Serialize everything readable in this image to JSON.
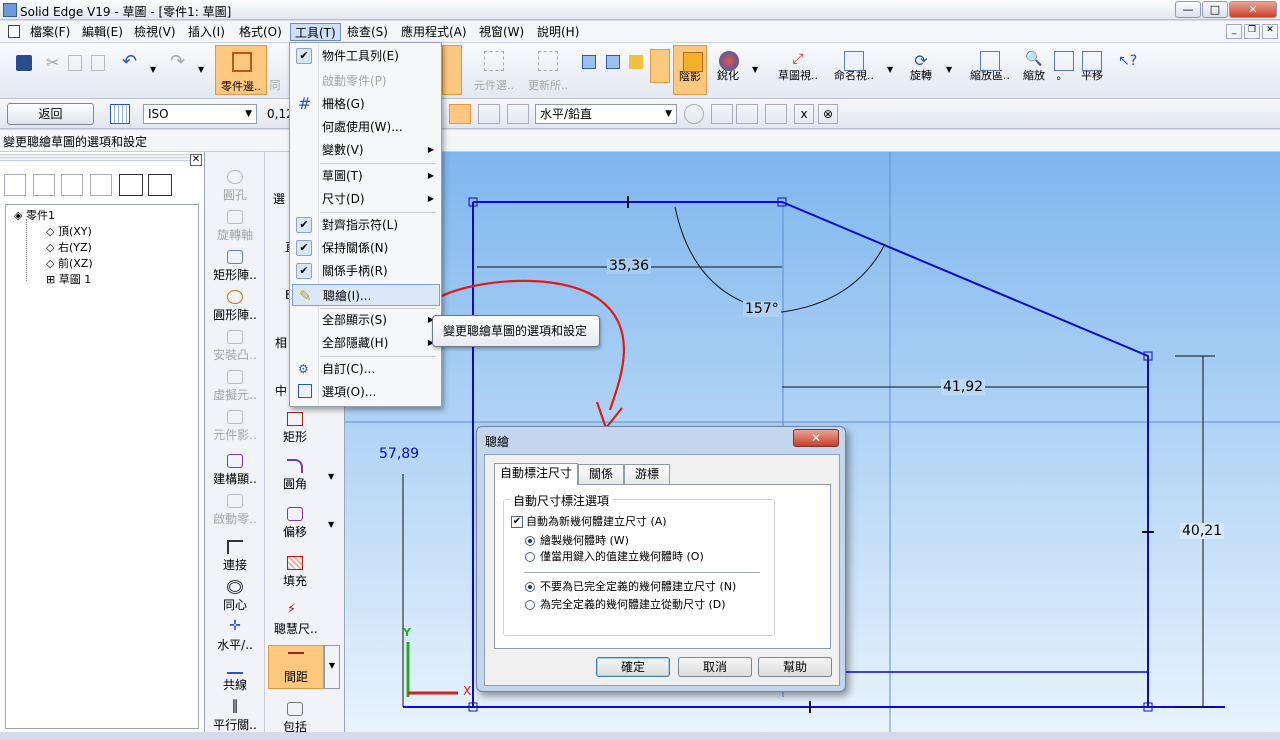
{
  "window": {
    "title": "Solid Edge V19 - 草圖 - [零件1: 草圖]",
    "min": "—",
    "max": "□",
    "close": "✕"
  },
  "menu": [
    "檔案(F)",
    "編輯(E)",
    "檢視(V)",
    "插入(I)",
    "格式(O)",
    "工具(T)",
    "檢查(S)",
    "應用程式(A)",
    "視窗(W)",
    "說明(H)"
  ],
  "toolbar": {
    "buttons": [
      "零件邊..",
      "同",
      "元件選..",
      "更新所..",
      "陰影",
      "銳化",
      "草圖視..",
      "命名視..",
      "旋轉",
      "縮放區..",
      "縮放",
      "。",
      "平移"
    ]
  },
  "toolbar2": {
    "back": "返回",
    "standard": "ISO",
    "value": "0,12",
    "align": "水平/鉛直"
  },
  "prompt": "變更聰繪草圖的選項和設定",
  "tree": {
    "root": "零件1",
    "items": [
      "頂(XY)",
      "右(YZ)",
      "前(XZ)",
      "草圖 1"
    ]
  },
  "ribbon1": [
    "圓孔",
    "旋轉軸",
    "矩形陣..",
    "圓形陣..",
    "安裝凸..",
    "虛擬元..",
    "元件影..",
    "建構顯..",
    "啟動零..",
    "連接",
    "同心",
    "水平/..",
    "共線",
    "平行關.."
  ],
  "ribbon2_partial": [
    "選",
    "直",
    "E",
    "相",
    "中"
  ],
  "ribbon2": [
    "矩形",
    "圓角",
    "偏移",
    "填充",
    "聰慧尺..",
    "間距",
    "包括"
  ],
  "dropdown": {
    "items": [
      {
        "label": "物件工具列(E)",
        "check": true
      },
      {
        "label": "啟動零件(P)",
        "disabled": true
      },
      {
        "label": "柵格(G)"
      },
      {
        "label": "何處使用(W)..."
      },
      {
        "label": "變數(V)",
        "submenu": true
      },
      {
        "label": "草圖(T)",
        "submenu": true
      },
      {
        "label": "尺寸(D)",
        "submenu": true
      },
      {
        "label": "對齊指示符(L)",
        "check": true
      },
      {
        "label": "保持關係(N)",
        "check": true
      },
      {
        "label": "關係手柄(R)",
        "check": true
      },
      {
        "label": "聰繪(I)...",
        "highlight": true
      },
      {
        "label": "全部顯示(S)",
        "submenu": true
      },
      {
        "label": "全部隱藏(H)",
        "submenu": true
      },
      {
        "label": "自訂(C)..."
      },
      {
        "label": "選項(O)..."
      }
    ]
  },
  "tooltip": "變更聰繪草圖的選項和設定",
  "dimensions": {
    "d1": "35,36",
    "d2": "157°",
    "d3": "41,92",
    "d4": "57,89",
    "d5": "40,21"
  },
  "axes": {
    "y": "Y",
    "x": "X"
  },
  "dialog": {
    "title": "聰繪",
    "close": "✕",
    "tabs": [
      "自動標注尺寸",
      "關係",
      "游標"
    ],
    "group": "自動尺寸標注選項",
    "checkbox": "自動為新幾何體建立尺寸 (A)",
    "radio1": [
      "繪製幾何體時 (W)",
      "僅當用鍵入的值建立幾何體時 (O)"
    ],
    "radio2": [
      "不要為已完全定義的幾何體建立尺寸 (N)",
      "為完全定義的幾何體建立從動尺寸 (D)"
    ],
    "buttons": [
      "確定",
      "取消",
      "幫助"
    ]
  },
  "colors": {
    "accent": "#ffc880",
    "sketch": "#0000c8",
    "annotation": "#e01b1b"
  }
}
